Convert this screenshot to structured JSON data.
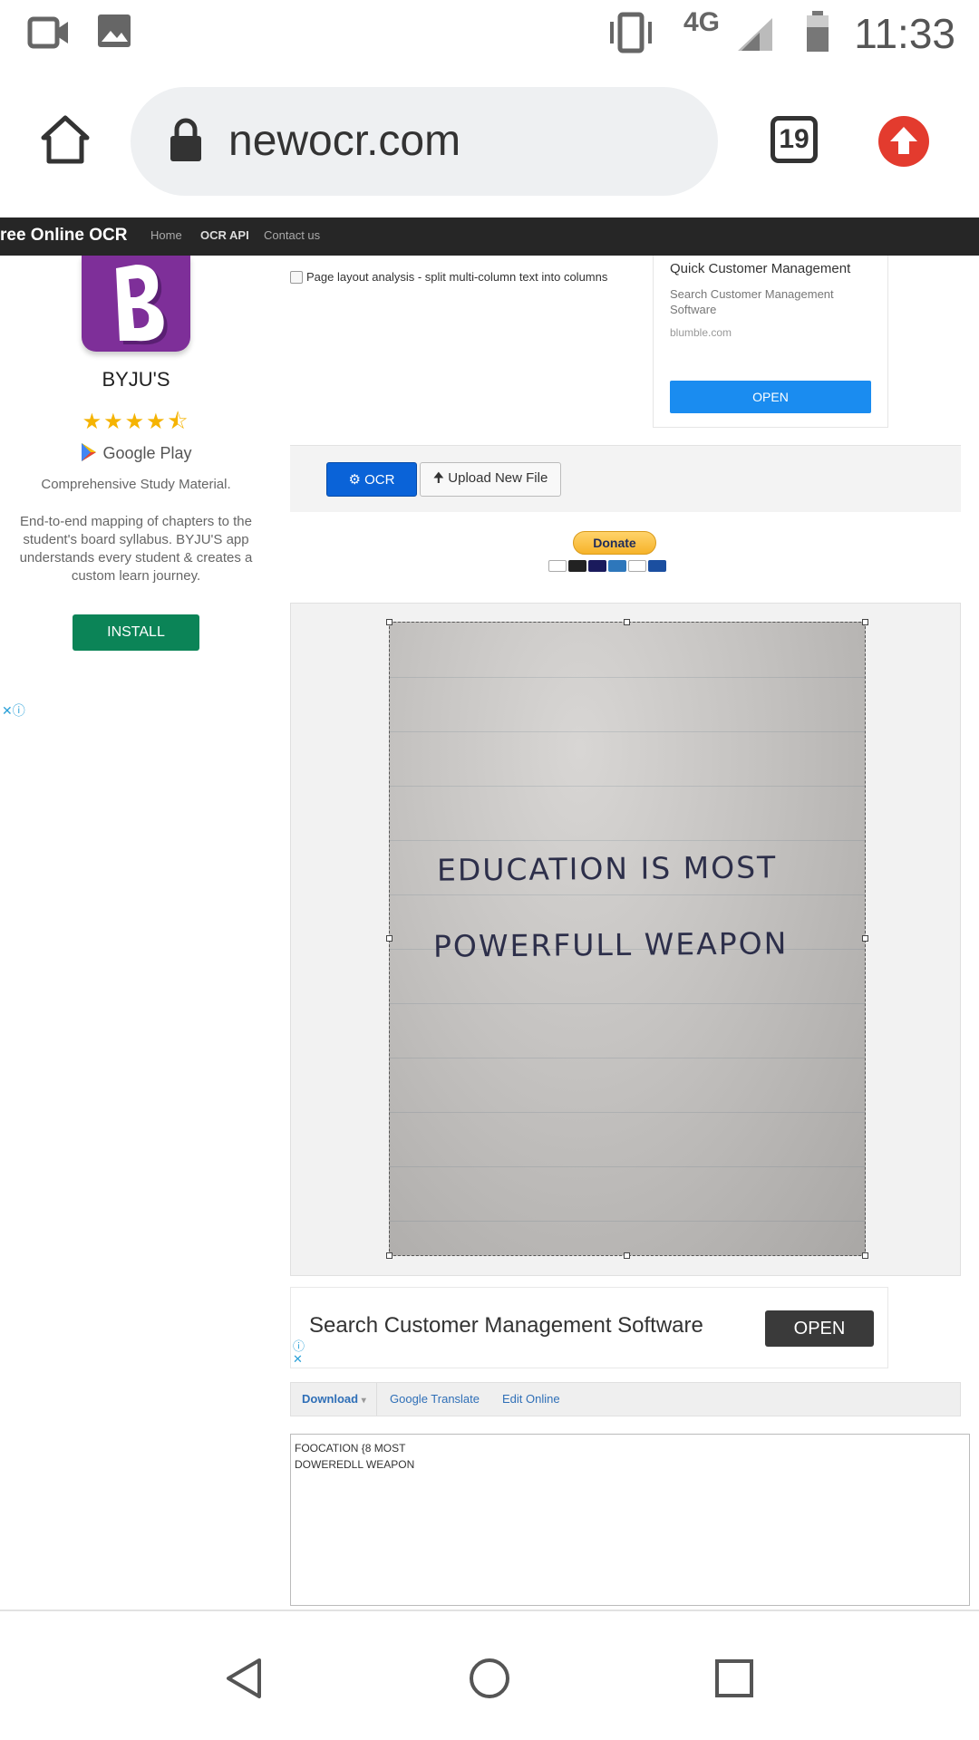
{
  "status_bar": {
    "network": "4G",
    "time": "11:33"
  },
  "browser": {
    "url": "newocr.com",
    "tab_count": "19"
  },
  "site_nav": {
    "brand": "ree Online OCR",
    "links": [
      "Home",
      "OCR API",
      "Contact us"
    ]
  },
  "left_ad": {
    "app_name": "BYJU'S",
    "rating_stars": "★★★★⯪",
    "store": "Google Play",
    "tagline": "Comprehensive Study Material.",
    "description": "End-to-end mapping of chapters to the student's board syllabus. BYJU'S app understands every student & creates a custom learn journey.",
    "install_label": "INSTALL"
  },
  "options": {
    "layout_analysis_label": "Page layout analysis - split multi-column text into columns"
  },
  "right_ad": {
    "title": "Quick Customer Management",
    "subtitle": "Search Customer Management Software",
    "domain": "blumble.com",
    "open_label": "OPEN"
  },
  "toolbar": {
    "ocr_label": "OCR",
    "upload_label": "Upload New File"
  },
  "donate": {
    "label": "Donate"
  },
  "image": {
    "line1": "EDUCATION  IS  MOST",
    "line2": "POWERFULL  WEAPON"
  },
  "bottom_ad": {
    "text": "Search Customer Management Software",
    "open_label": "OPEN"
  },
  "result": {
    "download_label": "Download",
    "translate_label": "Google Translate",
    "edit_label": "Edit Online",
    "text": "FOOCATION {8 MOST\nDOWEREDLL WEAPON"
  },
  "colors": {
    "accent_blue": "#0a63d8",
    "install_green": "#0b8457",
    "byjus_purple": "#7e2f99",
    "nav_dark": "#262626"
  }
}
